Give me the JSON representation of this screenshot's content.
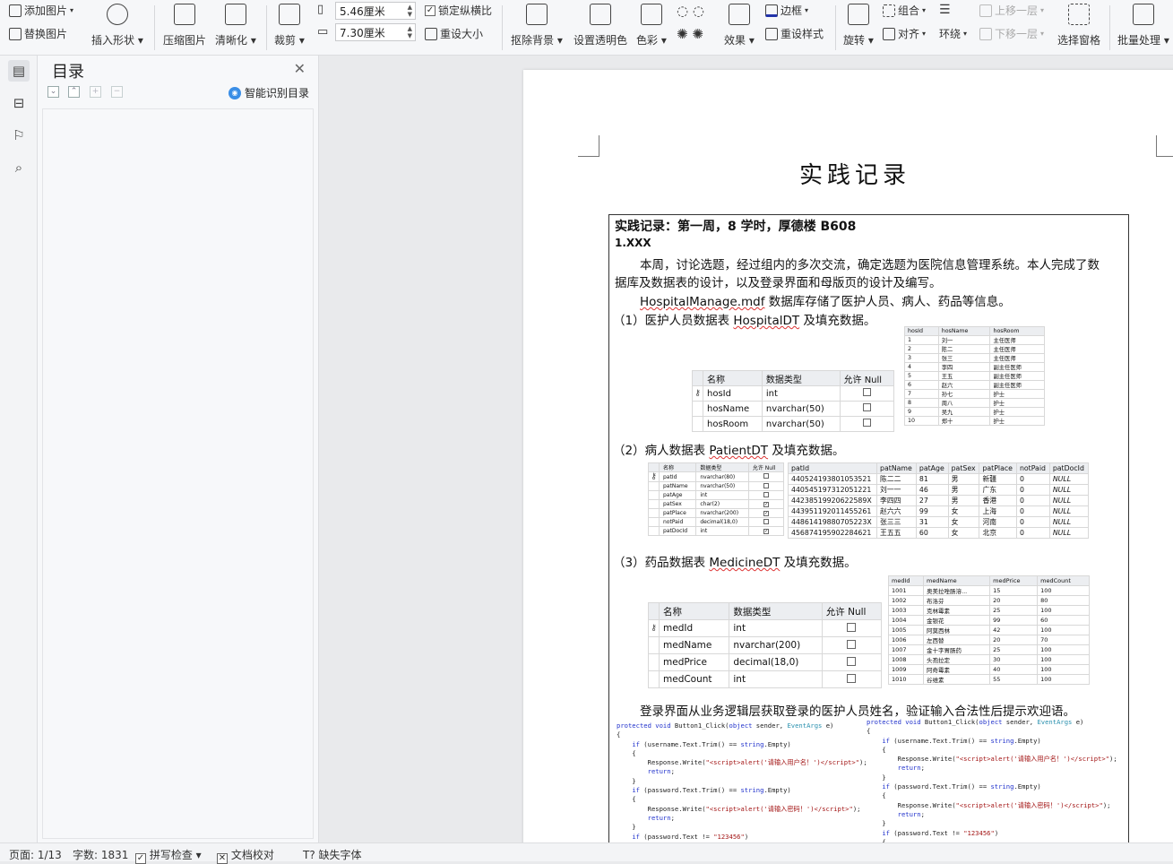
{
  "ribbon": {
    "add_image": "添加图片",
    "replace_image": "替换图片",
    "insert_shape": "插入形状",
    "compress": "压缩图片",
    "sharpen": "清晰化",
    "crop": "裁剪",
    "width_value": "5.46厘米",
    "height_value": "7.30厘米",
    "lock_ratio": "锁定纵横比",
    "reset_size": "重设大小",
    "remove_bg": "抠除背景",
    "set_transparent": "设置透明色",
    "color": "色彩",
    "effects": "效果",
    "border": "边框",
    "reset_style": "重设样式",
    "rotate": "旋转",
    "group": "组合",
    "align": "对齐",
    "wrap": "环绕",
    "bring_forward": "上移一层",
    "send_backward": "下移一层",
    "select_pane": "选择窗格",
    "batch": "批量处理"
  },
  "toc": {
    "title": "目录",
    "smart_detect": "智能识别目录"
  },
  "doc": {
    "heading": "实践记录",
    "week_line": "实践记录：第一周，8 学时，厚德楼 B608",
    "section": "1.XXX",
    "para1_l1": "本周，讨论选题，经过组内的多次交流，确定选题为医院信息管理系统。本人完成了数",
    "para1_l2": "据库及数据表的设计，以及登录界面和母版页的设计及编写。",
    "para2_a": "HospitalManage.mdf",
    "para2_b": " 数据库存储了医护人员、病人、药品等信息。",
    "item1_a": "（1）医护人员数据表 ",
    "item1_b": "HospitalDT",
    "item1_c": " 及填充数据。",
    "item2_a": "（2）病人数据表 ",
    "item2_b": "PatientDT",
    "item2_c": " 及填充数据。",
    "item3_a": "（3）药品数据表 ",
    "item3_b": "MedicineDT",
    "item3_c": " 及填充数据。",
    "login_para": "登录界面从业务逻辑层获取登录的医护人员姓名，验证输入合法性后提示欢迎语。"
  },
  "design_headers": [
    "名称",
    "数据类型",
    "允许 Null"
  ],
  "hosp_design": [
    {
      "name": "hosId",
      "type": "int",
      "key": true,
      "null": false
    },
    {
      "name": "hosName",
      "type": "nvarchar(50)",
      "key": false,
      "null": false
    },
    {
      "name": "hosRoom",
      "type": "nvarchar(50)",
      "key": false,
      "null": false
    }
  ],
  "hosp_data": {
    "headers": [
      "hosId",
      "hosName",
      "hosRoom"
    ],
    "rows": [
      [
        "1",
        "刘一",
        "主任医师"
      ],
      [
        "2",
        "陈二",
        "主任医师"
      ],
      [
        "3",
        "张三",
        "主任医师"
      ],
      [
        "4",
        "李四",
        "副主任医师"
      ],
      [
        "5",
        "王五",
        "副主任医师"
      ],
      [
        "6",
        "赵六",
        "副主任医师"
      ],
      [
        "7",
        "孙七",
        "护士"
      ],
      [
        "8",
        "周八",
        "护士"
      ],
      [
        "9",
        "吴九",
        "护士"
      ],
      [
        "10",
        "郑十",
        "护士"
      ]
    ]
  },
  "patient_design": [
    {
      "name": "patId",
      "type": "nvarchar(80)",
      "key": true,
      "null": false
    },
    {
      "name": "patName",
      "type": "nvarchar(50)",
      "key": false,
      "null": false
    },
    {
      "name": "patAge",
      "type": "int",
      "key": false,
      "null": false
    },
    {
      "name": "patSex",
      "type": "char(2)",
      "key": false,
      "null": true
    },
    {
      "name": "patPlace",
      "type": "nvarchar(200)",
      "key": false,
      "null": true
    },
    {
      "name": "notPaid",
      "type": "decimal(18,0)",
      "key": false,
      "null": false
    },
    {
      "name": "patDocId",
      "type": "int",
      "key": false,
      "null": true
    }
  ],
  "patient_data": {
    "headers": [
      "patId",
      "patName",
      "patAge",
      "patSex",
      "patPlace",
      "notPaid",
      "patDocId"
    ],
    "rows": [
      [
        "440524193801053521",
        "陈二二",
        "81",
        "男",
        "新疆",
        "0",
        "NULL"
      ],
      [
        "440545197312051221",
        "刘一一",
        "46",
        "男",
        "广东",
        "0",
        "NULL"
      ],
      [
        "44238519920622589X",
        "李四四",
        "27",
        "男",
        "香港",
        "0",
        "NULL"
      ],
      [
        "443951192011455261",
        "赵六六",
        "99",
        "女",
        "上海",
        "0",
        "NULL"
      ],
      [
        "44861419880705223X",
        "张三三",
        "31",
        "女",
        "河南",
        "0",
        "NULL"
      ],
      [
        "456874195902284621",
        "王五五",
        "60",
        "女",
        "北京",
        "0",
        "NULL"
      ]
    ]
  },
  "med_design": [
    {
      "name": "medId",
      "type": "int",
      "key": true,
      "null": false
    },
    {
      "name": "medName",
      "type": "nvarchar(200)",
      "key": false,
      "null": false
    },
    {
      "name": "medPrice",
      "type": "decimal(18,0)",
      "key": false,
      "null": false
    },
    {
      "name": "medCount",
      "type": "int",
      "key": false,
      "null": false
    }
  ],
  "med_data": {
    "headers": [
      "medId",
      "medName",
      "medPrice",
      "medCount"
    ],
    "rows": [
      [
        "1001",
        "奥美拉唑肠溶...",
        "15",
        "100"
      ],
      [
        "1002",
        "布洛芬",
        "20",
        "80"
      ],
      [
        "1003",
        "克林霉素",
        "25",
        "100"
      ],
      [
        "1004",
        "金银花",
        "99",
        "60"
      ],
      [
        "1005",
        "阿莫西林",
        "42",
        "100"
      ],
      [
        "1006",
        "左西替",
        "20",
        "70"
      ],
      [
        "1007",
        "金十字胃肠药",
        "25",
        "100"
      ],
      [
        "1008",
        "头孢拉定",
        "30",
        "100"
      ],
      [
        "1009",
        "阿奇霉素",
        "40",
        "100"
      ],
      [
        "1010",
        "谷维素",
        "55",
        "100"
      ]
    ]
  },
  "statusbar": {
    "page": "页面: 1/13",
    "words": "字数: 1831",
    "spell": "拼写检查",
    "proof": "文档校对",
    "missing_font": "缺失字体"
  }
}
